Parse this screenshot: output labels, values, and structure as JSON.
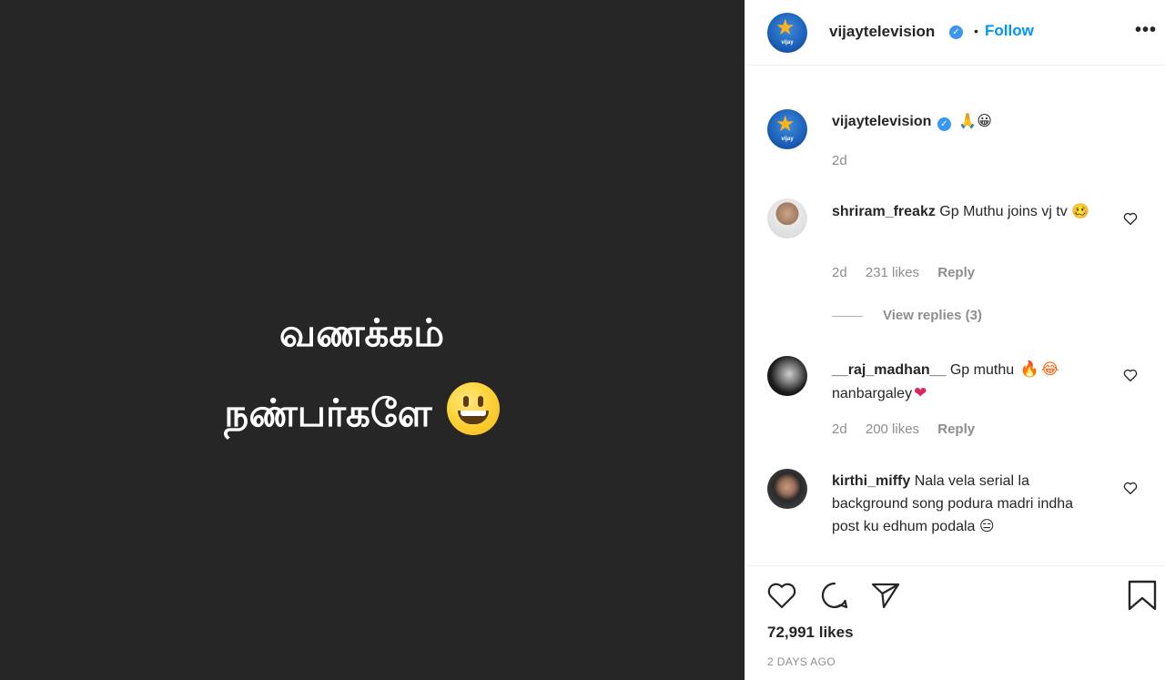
{
  "media": {
    "line1": "வணக்கம்",
    "line2": "நண்பர்களே",
    "emoji": "grinning-face"
  },
  "header": {
    "username": "vijaytelevision",
    "avatar_brand": "vijay",
    "separator": "•",
    "follow_label": "Follow",
    "more_label": "•••"
  },
  "caption": {
    "username": "vijaytelevision",
    "text": "🙏😀",
    "time": "2d"
  },
  "comments": [
    {
      "username": "shriram_freakz",
      "text": "Gp Muthu joins vj tv",
      "emoji": "🥴",
      "time": "2d",
      "likes": "231 likes",
      "reply": "Reply",
      "view_replies": "View replies (3)"
    },
    {
      "username": "__raj_madhan__",
      "text": "Gp muthu",
      "emoji_fire": "🔥",
      "emoji_laugh": "😂",
      "text2": "nanbargaley",
      "emoji_heart": "❤",
      "time": "2d",
      "likes": "200 likes",
      "reply": "Reply"
    },
    {
      "username": "kirthi_miffy",
      "text": "Nala vela serial la background song podura madri indha post ku edhum podala",
      "emoji": "😑"
    }
  ],
  "actions": {
    "likes": "72,991 likes",
    "posted": "2 DAYS AGO"
  },
  "colors": {
    "media_bg": "#262626",
    "link_blue": "#0095f6",
    "verified_blue": "#3897f0",
    "muted": "#8e8e8e"
  }
}
